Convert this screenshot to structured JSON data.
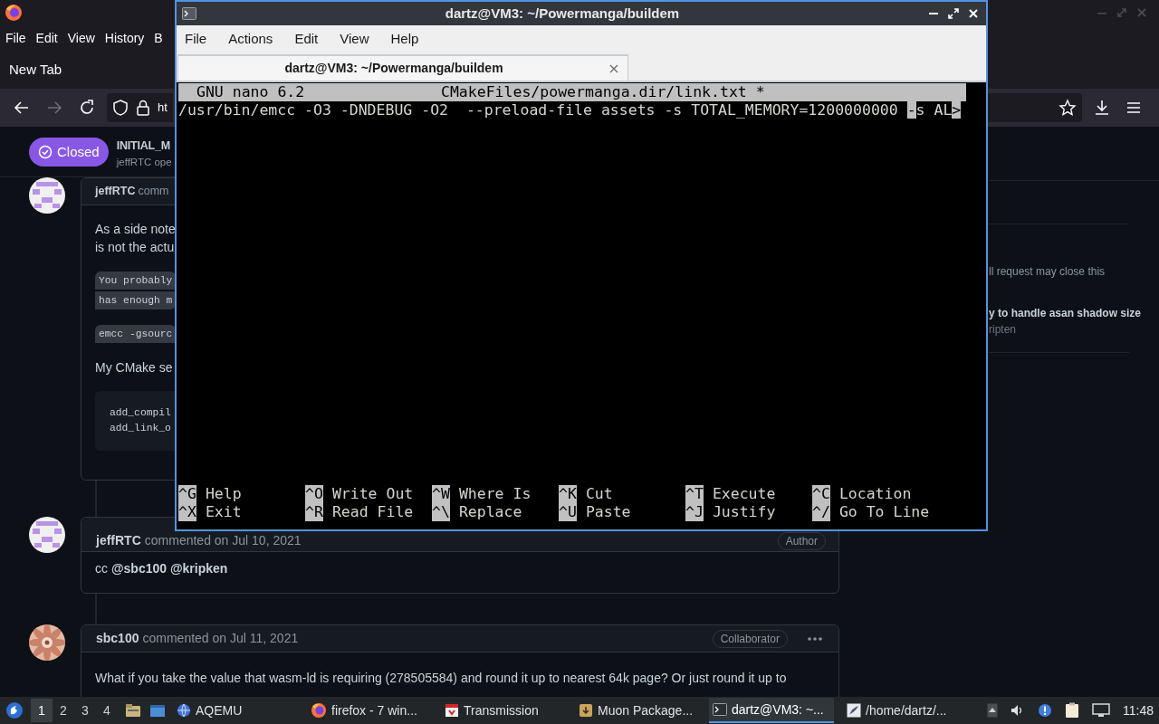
{
  "browser": {
    "menu": [
      "File",
      "Edit",
      "View",
      "History",
      "B"
    ],
    "tab": {
      "label": "New Tab",
      "selected": true
    },
    "url": "ht",
    "issue": {
      "status": "Closed",
      "title": "INITIAL_M",
      "byline": "jeffRTC ope"
    },
    "comments": [
      {
        "kind": "identicon",
        "author": "jeffRTC",
        "action": "comm",
        "body": [
          {
            "kind": "text",
            "lines": [
              "As a side note",
              "is not the actu"
            ]
          },
          {
            "kind": "code_inline",
            "lines": [
              "You probably",
              "has enough m"
            ]
          },
          {
            "kind": "code_inline",
            "lines": [
              "emcc -gsourc"
            ]
          },
          {
            "kind": "text",
            "lines": [
              "My CMake se"
            ]
          },
          {
            "kind": "code_block",
            "lines": [
              "add_compil",
              "add_link_o"
            ]
          }
        ]
      },
      {
        "kind": "identicon",
        "author": "jeffRTC",
        "action": "commented on Jul 10, 2021",
        "badge": "Author",
        "body": [
          {
            "kind": "text",
            "lines": [
              "cc **@sbc100** **@kripken**"
            ]
          }
        ]
      },
      {
        "author": "sbc100",
        "action": "commented on Jul 11, 2021",
        "badge": "Collaborator",
        "menu": true,
        "body": [
          {
            "kind": "text",
            "lines": [
              "What if you take the value that wasm-ld is requiring (278505584) and round it up to nearest 64k page? Or just round it up to"
            ]
          }
        ]
      }
    ],
    "sidebar": [
      {
        "kind": "text",
        "text": "ll request may close this"
      },
      {
        "kind": "link",
        "text": "y to handle asan shadow size"
      },
      {
        "kind": "meta",
        "text": "ripten"
      }
    ]
  },
  "terminal": {
    "title": "dartz@VM3: ~/Powermanga/buildem",
    "menu": [
      "File",
      "Actions",
      "Edit",
      "View",
      "Help"
    ],
    "tabs": [
      {
        "label": "dartz@VM3: ~/Powermanga/buildem",
        "selected": true
      }
    ],
    "nano": {
      "version": "GNU nano 6.2",
      "file": "CMakeFiles/powermanga.dir/link.txt *",
      "lines": [
        [
          {
            "text": "/usr/bin/emcc -O3 -DNDEBUG -O2  --preload-file assets -s TOTAL_MEMORY=1200000000 ",
            "highlight": false
          },
          {
            "text": "-",
            "highlight": true
          },
          {
            "text": "s AL",
            "highlight": false
          },
          {
            "text": ">",
            "highlight": true
          }
        ]
      ],
      "shortcuts": [
        [
          {
            "key": "^G",
            "label": "Help"
          },
          {
            "key": "^O",
            "label": "Write Out"
          },
          {
            "key": "^W",
            "label": "Where Is"
          },
          {
            "key": "^K",
            "label": "Cut"
          },
          {
            "key": "^T",
            "label": "Execute"
          },
          {
            "key": "^C",
            "label": "Location"
          }
        ],
        [
          {
            "key": "^X",
            "label": "Exit"
          },
          {
            "key": "^R",
            "label": "Read File"
          },
          {
            "key": "^\\",
            "label": "Replace"
          },
          {
            "key": "^U",
            "label": "Paste"
          },
          {
            "key": "^J",
            "label": "Justify"
          },
          {
            "key": "^/",
            "label": "Go To Line"
          }
        ]
      ]
    }
  },
  "taskbar": {
    "workspaces": [
      {
        "label": "1",
        "selected": true
      },
      {
        "label": "2",
        "selected": false
      },
      {
        "label": "3",
        "selected": false
      },
      {
        "label": "4",
        "selected": false
      }
    ],
    "tasks": [
      {
        "kind": "globe",
        "label": "AQEMU",
        "selected": false
      },
      {
        "kind": "firefox",
        "label": "firefox - 7 win...",
        "selected": false
      },
      {
        "kind": "transmission",
        "label": "Transmission",
        "selected": false
      },
      {
        "kind": "package",
        "label": "Muon Package...",
        "selected": false
      },
      {
        "kind": "terminal",
        "label": "dartz@VM3: ~...",
        "selected": true
      },
      {
        "kind": "editor",
        "label": "/home/dartz/...",
        "selected": false
      }
    ],
    "clock": "11:48"
  }
}
